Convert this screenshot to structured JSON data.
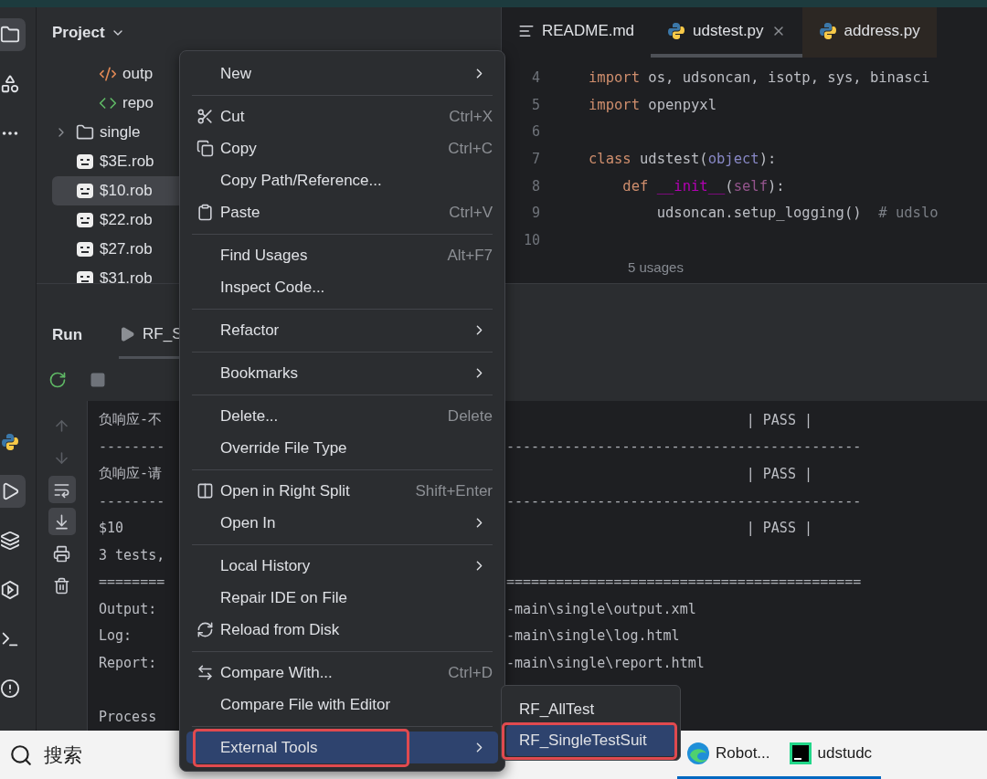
{
  "activity_bar": {
    "top": [
      {
        "selected": true
      },
      {
        "selected": false
      },
      {
        "selected": false
      }
    ],
    "bottom": [
      {
        "selected": false
      },
      {
        "selected": true
      },
      {
        "selected": false
      },
      {
        "selected": false
      },
      {
        "selected": false
      },
      {
        "selected": false
      }
    ]
  },
  "project": {
    "title": "Project",
    "tree": [
      {
        "children": [
          {
            "label": "outp",
            "kind": "xml",
            "selected": false
          },
          {
            "label": "repo",
            "kind": "html",
            "selected": false
          }
        ]
      },
      {
        "label": "single",
        "kind": "folder",
        "expanded": false,
        "selected": false
      },
      {
        "label": "$3E.rob",
        "kind": "robot",
        "selected": false
      },
      {
        "label": "$10.rob",
        "kind": "robot",
        "selected": true
      },
      {
        "label": "$22.rob",
        "kind": "robot",
        "selected": false
      },
      {
        "label": "$27.rob",
        "kind": "robot",
        "selected": false
      },
      {
        "label": "$31.rob",
        "kind": "robot",
        "selected": false
      }
    ]
  },
  "editor": {
    "tabs": [
      {
        "label": "README.md",
        "kind": "markdown",
        "selected": false,
        "closable": false
      },
      {
        "label": "udstest.py",
        "kind": "python",
        "selected": true,
        "closable": true
      },
      {
        "label": "address.py",
        "kind": "python",
        "selected": false,
        "closable": false
      }
    ],
    "lines": [
      {
        "number": "4",
        "tokens": [
          {
            "kind": "keyword",
            "text": "import"
          },
          {
            "kind": "plain",
            "text": " os, udsoncan, isotp, sys, binasci"
          }
        ]
      },
      {
        "number": "5",
        "tokens": [
          {
            "kind": "keyword",
            "text": "import"
          },
          {
            "kind": "plain",
            "text": " openpyxl"
          }
        ]
      },
      {
        "number": "6"
      },
      {
        "number": "7",
        "tokens": [
          {
            "kind": "keyword",
            "text": "class"
          },
          {
            "kind": "plain",
            "text": " udstest("
          },
          {
            "kind": "builtin",
            "text": "object"
          },
          {
            "kind": "plain",
            "text": "):"
          }
        ]
      },
      {
        "number": "8",
        "tokens": [
          {
            "kind": "keyword",
            "text": "    def "
          },
          {
            "kind": "magic",
            "text": "__init__"
          },
          {
            "kind": "plain",
            "text": "("
          },
          {
            "kind": "self",
            "text": "self"
          },
          {
            "kind": "plain",
            "text": "):"
          }
        ]
      },
      {
        "number": "9",
        "tokens": [
          {
            "kind": "plain",
            "text": "        udsoncan.setup_logging()  "
          },
          {
            "kind": "comment",
            "text": "# udslo"
          }
        ]
      },
      {
        "number": "10"
      }
    ],
    "hint": "5 usages"
  },
  "run": {
    "title": "Run",
    "tab": "RF_S",
    "toolbar": [
      {
        "selected": false
      },
      {
        "selected": false
      }
    ],
    "side_tools": [
      {
        "selected": false
      },
      {
        "selected": false
      },
      {
        "selected": true
      },
      {
        "selected": true
      },
      {
        "selected": false
      },
      {
        "selected": false
      }
    ],
    "console": [
      {
        "kind": "status",
        "left": "负响应-不",
        "right": "| PASS |"
      },
      {
        "kind": "rule",
        "left": "--------",
        "right": "-------------------------------------------"
      },
      {
        "kind": "status",
        "left": "负响应-请",
        "right": "| PASS |"
      },
      {
        "kind": "rule",
        "left": "--------",
        "right": "-------------------------------------------"
      },
      {
        "kind": "status",
        "left": "$10",
        "right": "| PASS |"
      },
      {
        "kind": "text",
        "left": "3 tests,"
      },
      {
        "kind": "rule",
        "left": "========",
        "right": "==========================================="
      },
      {
        "kind": "text",
        "left": "Output:",
        "right": "-main\\single\\output.xml"
      },
      {
        "kind": "text",
        "left": "Log:",
        "right": "-main\\single\\log.html"
      },
      {
        "kind": "text",
        "left": "Report:",
        "right": "-main\\single\\report.html"
      },
      {
        "kind": "blank"
      },
      {
        "kind": "text",
        "left": "Process"
      }
    ]
  },
  "context_menu": [
    {
      "kind": "item",
      "label": "New",
      "submenu": true,
      "selected": false
    },
    {
      "kind": "separator"
    },
    {
      "kind": "item",
      "label": "Cut",
      "shortcut": "Ctrl+X",
      "selected": false
    },
    {
      "kind": "item",
      "label": "Copy",
      "shortcut": "Ctrl+C",
      "selected": false
    },
    {
      "kind": "item",
      "label": "Copy Path/Reference...",
      "selected": false
    },
    {
      "kind": "item",
      "label": "Paste",
      "shortcut": "Ctrl+V",
      "selected": false
    },
    {
      "kind": "separator"
    },
    {
      "kind": "item",
      "label": "Find Usages",
      "shortcut": "Alt+F7",
      "selected": false
    },
    {
      "kind": "item",
      "label": "Inspect Code...",
      "selected": false
    },
    {
      "kind": "separator"
    },
    {
      "kind": "item",
      "label": "Refactor",
      "submenu": true,
      "selected": false
    },
    {
      "kind": "separator"
    },
    {
      "kind": "item",
      "label": "Bookmarks",
      "submenu": true,
      "selected": false
    },
    {
      "kind": "separator"
    },
    {
      "kind": "item",
      "label": "Delete...",
      "shortcut": "Delete",
      "selected": false
    },
    {
      "kind": "item",
      "label": "Override File Type",
      "selected": false
    },
    {
      "kind": "separator"
    },
    {
      "kind": "item",
      "label": "Open in Right Split",
      "shortcut": "Shift+Enter",
      "selected": false
    },
    {
      "kind": "item",
      "label": "Open In",
      "submenu": true,
      "selected": false
    },
    {
      "kind": "separator"
    },
    {
      "kind": "item",
      "label": "Local History",
      "submenu": true,
      "selected": false
    },
    {
      "kind": "item",
      "label": "Repair IDE on File",
      "selected": false
    },
    {
      "kind": "item",
      "label": "Reload from Disk",
      "selected": false
    },
    {
      "kind": "separator"
    },
    {
      "kind": "item",
      "label": "Compare With...",
      "shortcut": "Ctrl+D",
      "selected": false
    },
    {
      "kind": "item",
      "label": "Compare File with Editor",
      "selected": false
    },
    {
      "kind": "separator"
    },
    {
      "kind": "item",
      "label": "External Tools",
      "submenu": true,
      "selected": true,
      "marked": true
    }
  ],
  "submenu": [
    {
      "label": "RF_AllTest",
      "selected": false,
      "marked": false
    },
    {
      "label": "RF_SingleTestSuit",
      "selected": true,
      "marked": true
    }
  ],
  "taskbar": {
    "search": "搜索",
    "apps": [
      {
        "label": "Robot...",
        "kind": "browser"
      },
      {
        "label": "udstudc",
        "kind": "ide"
      }
    ]
  }
}
